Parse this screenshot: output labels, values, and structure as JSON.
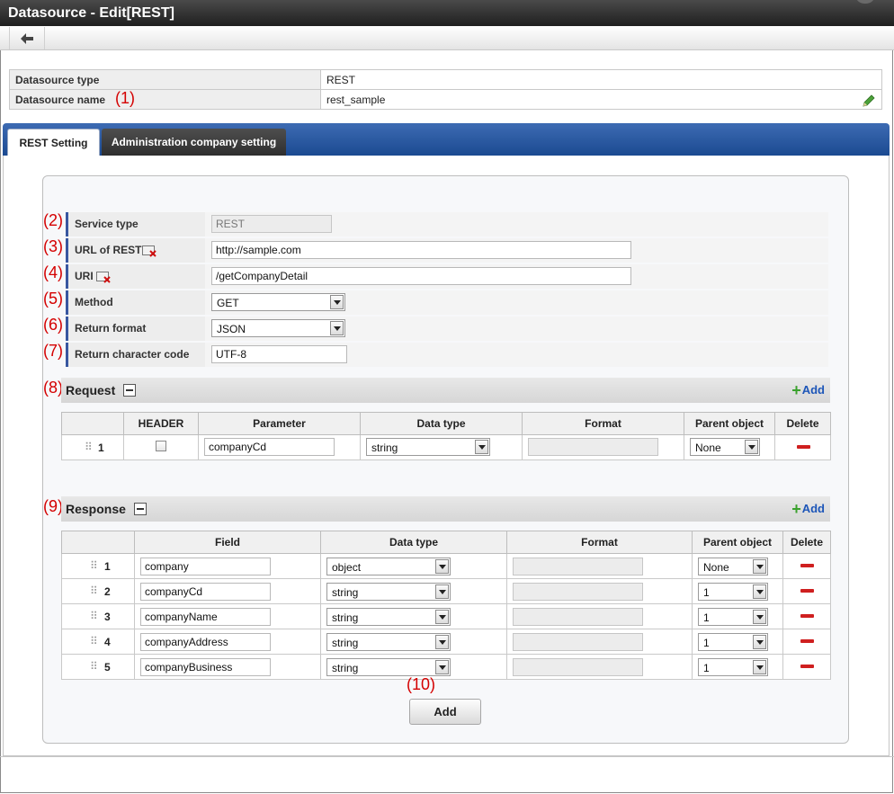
{
  "window": {
    "title": "Datasource - Edit[REST]"
  },
  "header_info": {
    "type_label": "Datasource type",
    "type_value": "REST",
    "name_label": "Datasource name",
    "name_value": "rest_sample"
  },
  "tabs": [
    {
      "label": "REST Setting",
      "active": true
    },
    {
      "label": "Administration company setting",
      "active": false
    }
  ],
  "markers": [
    "(1)",
    "(2)",
    "(3)",
    "(4)",
    "(5)",
    "(6)",
    "(7)",
    "(8)",
    "(9)",
    "(10)"
  ],
  "settings": {
    "service_type": {
      "label": "Service type",
      "value": "REST"
    },
    "url": {
      "label": "URL of REST",
      "value": "http://sample.com"
    },
    "uri": {
      "label": "URI",
      "value": "/getCompanyDetail"
    },
    "method": {
      "label": "Method",
      "value": "GET"
    },
    "return_format": {
      "label": "Return format",
      "value": "JSON"
    },
    "return_charset": {
      "label": "Return character code",
      "value": "UTF-8"
    }
  },
  "request": {
    "title": "Request",
    "add_label": "Add",
    "columns": [
      "HEADER",
      "Parameter",
      "Data type",
      "Format",
      "Parent object",
      "Delete"
    ],
    "rows": [
      {
        "num": "1",
        "header": false,
        "parameter": "companyCd",
        "data_type": "string",
        "format": "",
        "parent": "None"
      }
    ]
  },
  "response": {
    "title": "Response",
    "add_label": "Add",
    "columns": [
      "Field",
      "Data type",
      "Format",
      "Parent object",
      "Delete"
    ],
    "rows": [
      {
        "num": "1",
        "field": "company",
        "data_type": "object",
        "format": "",
        "parent": "None"
      },
      {
        "num": "2",
        "field": "companyCd",
        "data_type": "string",
        "format": "",
        "parent": "1"
      },
      {
        "num": "3",
        "field": "companyName",
        "data_type": "string",
        "format": "",
        "parent": "1"
      },
      {
        "num": "4",
        "field": "companyAddress",
        "data_type": "string",
        "format": "",
        "parent": "1"
      },
      {
        "num": "5",
        "field": "companyBusiness",
        "data_type": "string",
        "format": "",
        "parent": "1"
      }
    ]
  },
  "footer": {
    "add_button_label": "Add"
  },
  "colors": {
    "accent_blue": "#1b4a91",
    "marker_red": "#d40000",
    "delete_red": "#cf1f1f",
    "add_green": "#3aa12d"
  },
  "icons": [
    "back-arrow-icon",
    "pencil-icon",
    "required-field-icon",
    "collapse-icon",
    "plus-icon",
    "grip-icon",
    "delete-icon",
    "dropdown-arrow-icon"
  ]
}
